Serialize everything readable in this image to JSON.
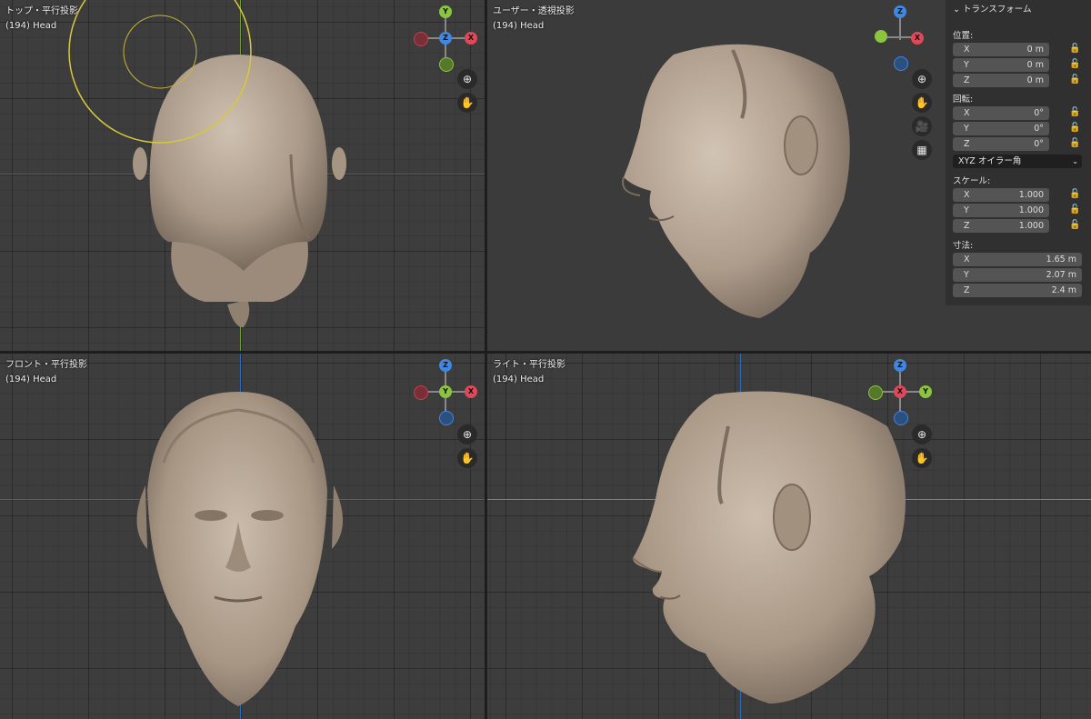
{
  "viewports": {
    "top": {
      "title": "トップ・平行投影",
      "object": "(194) Head"
    },
    "user": {
      "title": "ユーザー・透視投影",
      "object": "(194) Head"
    },
    "front": {
      "title": "フロント・平行投影",
      "object": "(194) Head"
    },
    "right": {
      "title": "ライト・平行投影",
      "object": "(194) Head"
    }
  },
  "gizmo_labels": {
    "x": "X",
    "y": "Y",
    "z": "Z"
  },
  "icons": {
    "zoom": "zoom-icon",
    "pan": "hand-pan-icon",
    "camera": "camera-icon",
    "grid": "grid-perspective-icon",
    "lock": "lock-icon"
  },
  "colors": {
    "x_axis": "#e0485a",
    "y_axis": "#8bc43f",
    "z_axis": "#3f87e0",
    "sculpt": "#b5a493",
    "brush": "#d8c83a",
    "panel": "#303030"
  },
  "transform": {
    "header": "トランスフォーム",
    "location": {
      "label": "位置:",
      "x": "0 m",
      "y": "0 m",
      "z": "0 m"
    },
    "rotation": {
      "label": "回転:",
      "x": "0°",
      "y": "0°",
      "z": "0°"
    },
    "rotation_mode": "XYZ オイラー角",
    "scale": {
      "label": "スケール:",
      "x": "1.000",
      "y": "1.000",
      "z": "1.000"
    },
    "dimensions": {
      "label": "寸法:",
      "x": "1.65 m",
      "y": "2.07 m",
      "z": "2.4 m"
    }
  }
}
